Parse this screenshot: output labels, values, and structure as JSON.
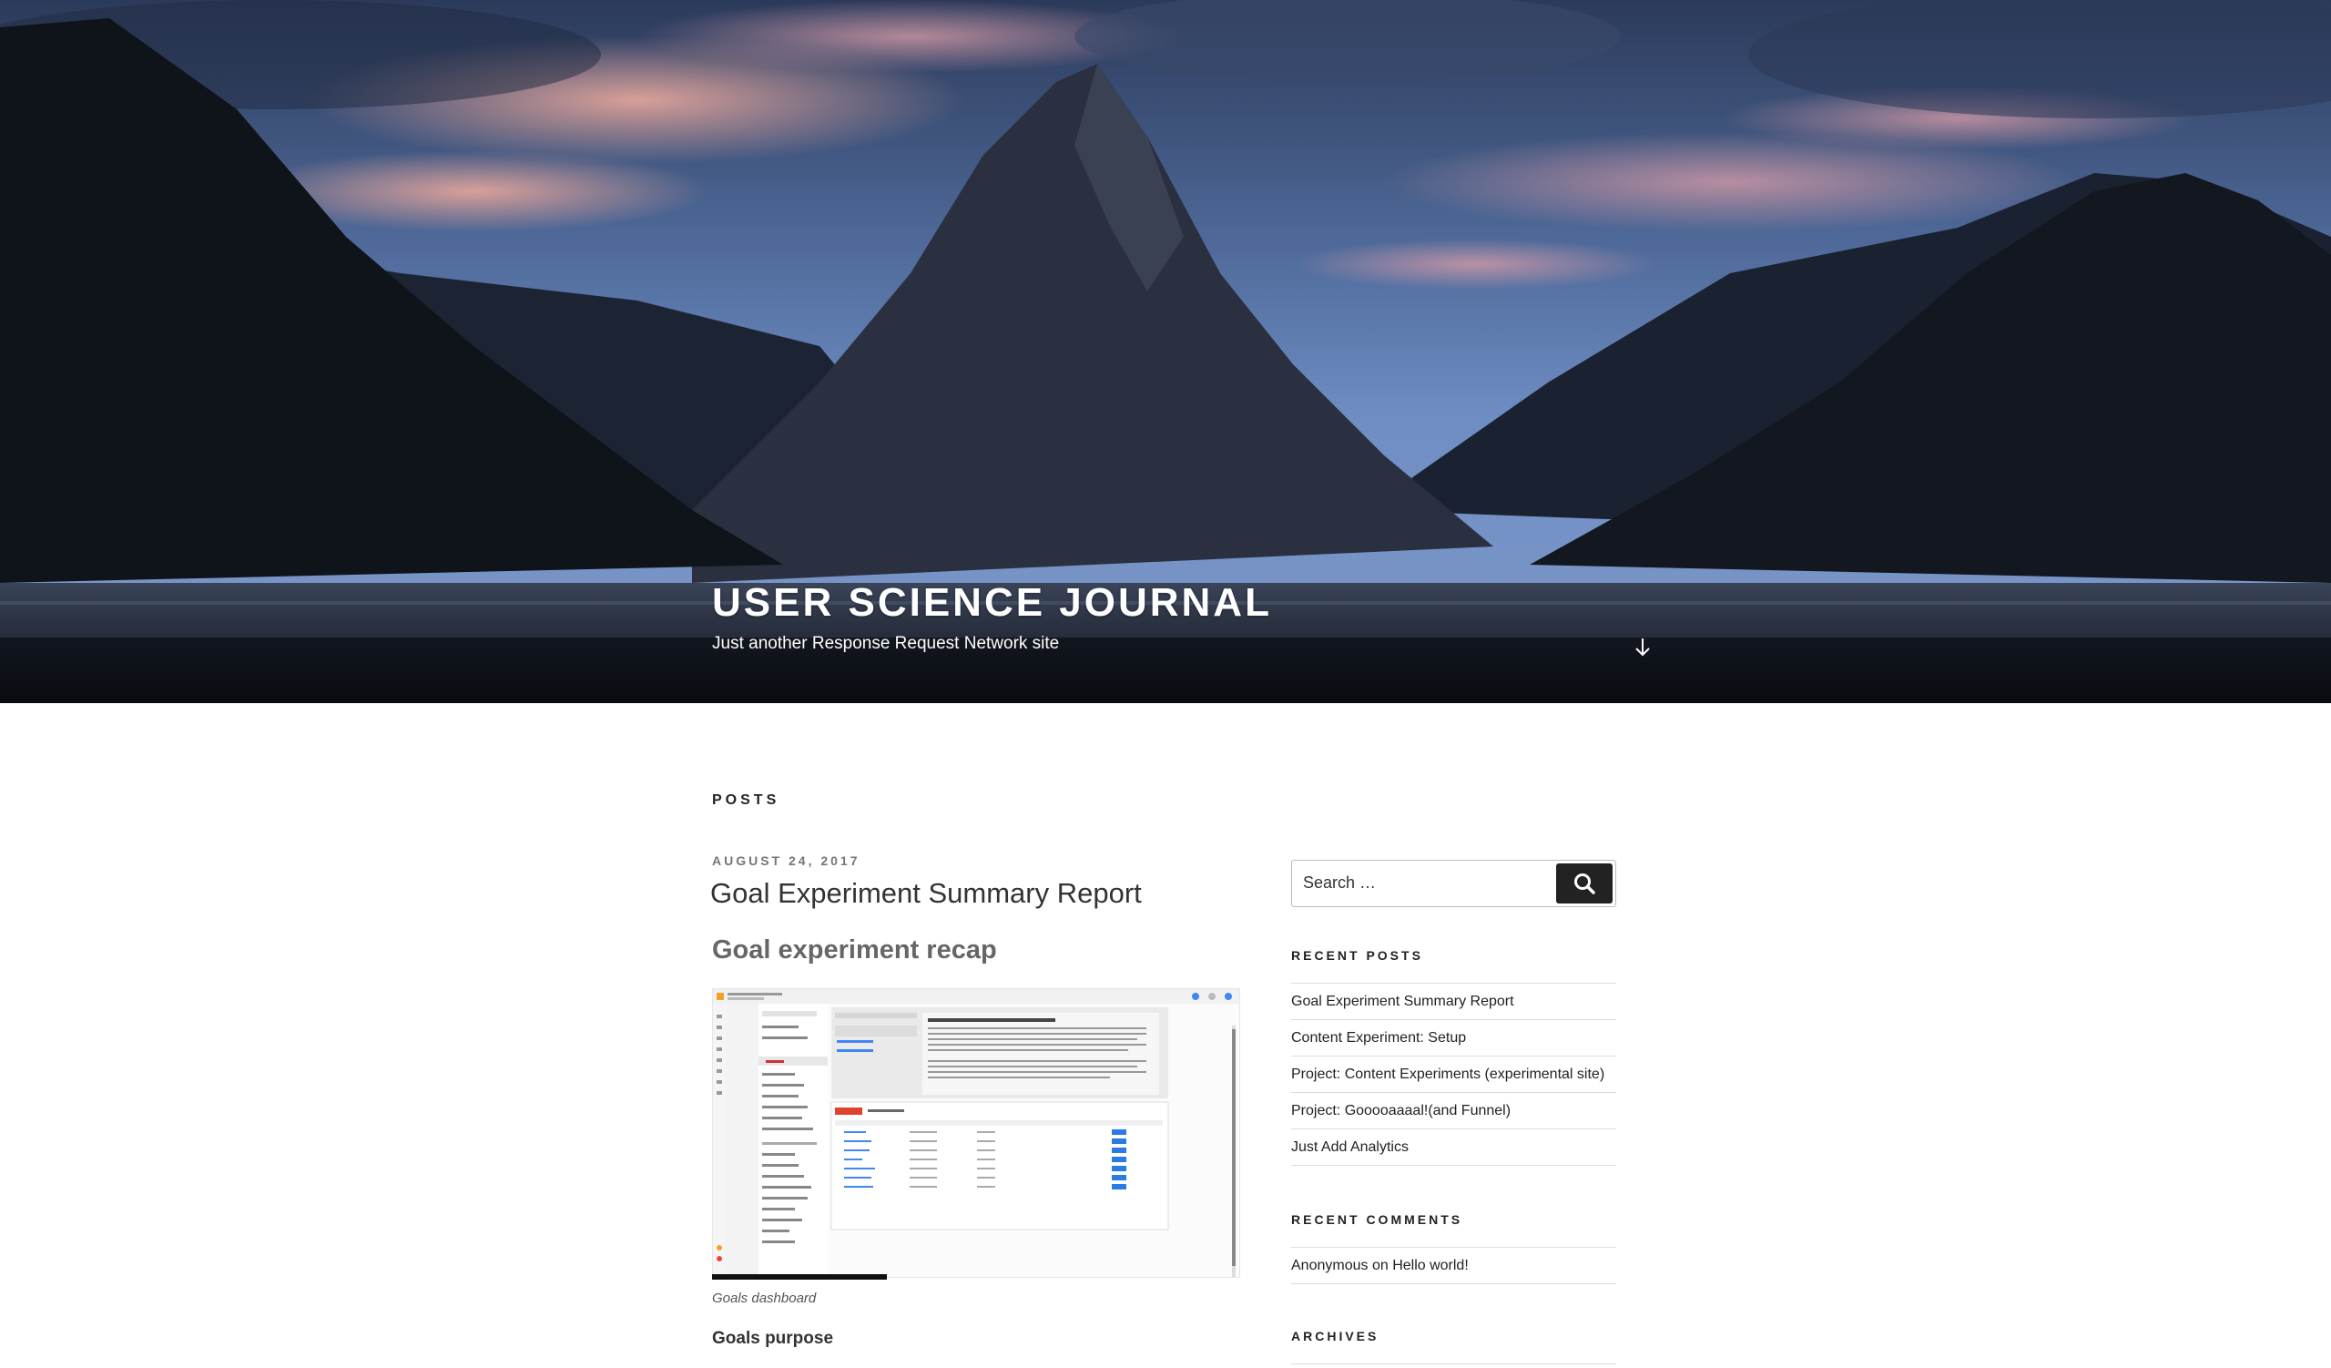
{
  "site": {
    "title": "USER SCIENCE JOURNAL",
    "description": "Just another Response Request Network site"
  },
  "icons": {
    "scroll_down": "arrow-down-icon",
    "search": "search-icon"
  },
  "main": {
    "page_label": "POSTS",
    "post": {
      "date": "AUGUST 24, 2017",
      "title": "Goal Experiment Summary Report",
      "heading": "Goal experiment recap",
      "image_caption": "Goals dashboard",
      "subheading": "Goals purpose"
    }
  },
  "sidebar": {
    "search_placeholder": "Search …",
    "recent_posts_title": "RECENT POSTS",
    "recent_posts": [
      "Goal Experiment Summary Report",
      "Content Experiment: Setup",
      "Project: Content Experiments (experimental site)",
      "Project: Gooooaaaal!(and Funnel)",
      "Just Add Analytics"
    ],
    "recent_comments_title": "RECENT COMMENTS",
    "recent_comments": [
      {
        "author": "Anonymous",
        "connector": " on ",
        "post": "Hello world!"
      }
    ],
    "archives_title": "ARCHIVES"
  }
}
